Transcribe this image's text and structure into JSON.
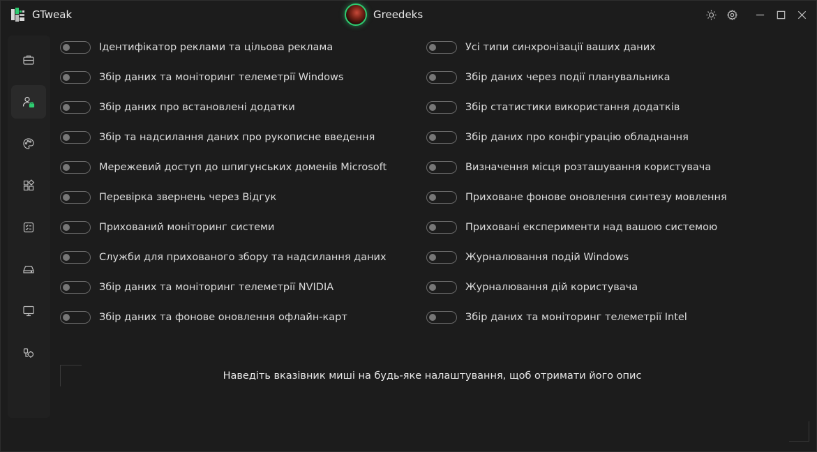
{
  "app": {
    "name": "GTweak",
    "brand_color": "#2ecc71"
  },
  "profile": {
    "name": "Greedeks"
  },
  "title_icons": [
    "sun-icon",
    "gear-icon",
    "minimize-icon",
    "maximize-icon",
    "close-icon"
  ],
  "sidebar": {
    "items": [
      {
        "icon": "briefcase-icon",
        "active": false
      },
      {
        "icon": "user-lock-icon",
        "active": true
      },
      {
        "icon": "palette-icon",
        "active": false
      },
      {
        "icon": "apps-icon",
        "active": false
      },
      {
        "icon": "checklist-icon",
        "active": false
      },
      {
        "icon": "drive-icon",
        "active": false
      },
      {
        "icon": "monitor-icon",
        "active": false
      },
      {
        "icon": "services-icon",
        "active": false
      }
    ]
  },
  "settings": {
    "left": [
      {
        "label": "Ідентифікатор реклами та цільова реклама",
        "enabled": false
      },
      {
        "label": "Збір даних та моніторинг телеметрії Windows",
        "enabled": false
      },
      {
        "label": "Збір даних про встановлені додатки",
        "enabled": false
      },
      {
        "label": "Збір та надсилання даних про рукописне введення",
        "enabled": false
      },
      {
        "label": "Мережевий доступ до шпигунських доменів Microsoft",
        "enabled": false
      },
      {
        "label": "Перевірка звернень через Відгук",
        "enabled": false
      },
      {
        "label": "Прихований моніторинг системи",
        "enabled": false
      },
      {
        "label": "Служби для прихованого збору та надсилання даних",
        "enabled": false
      },
      {
        "label": "Збір даних та моніторинг телеметрії NVIDIA",
        "enabled": false
      },
      {
        "label": "Збір даних та фонове оновлення офлайн-карт",
        "enabled": false
      }
    ],
    "right": [
      {
        "label": "Усі типи синхронізації ваших даних",
        "enabled": false
      },
      {
        "label": "Збір даних через події планувальника",
        "enabled": false
      },
      {
        "label": "Збір статистики використання додатків",
        "enabled": false
      },
      {
        "label": "Збір даних про конфігурацію обладнання",
        "enabled": false
      },
      {
        "label": "Визначення місця розташування користувача",
        "enabled": false
      },
      {
        "label": "Приховане фонове оновлення синтезу мовлення",
        "enabled": false
      },
      {
        "label": "Приховані експерименти над вашою системою",
        "enabled": false
      },
      {
        "label": "Журналювання подій Windows",
        "enabled": false
      },
      {
        "label": "Журналювання дій користувача",
        "enabled": false
      },
      {
        "label": "Збір даних та моніторинг телеметрії Intel",
        "enabled": false
      }
    ]
  },
  "description": "Наведіть вказівник миші на будь-яке налаштування, щоб отримати його опис"
}
